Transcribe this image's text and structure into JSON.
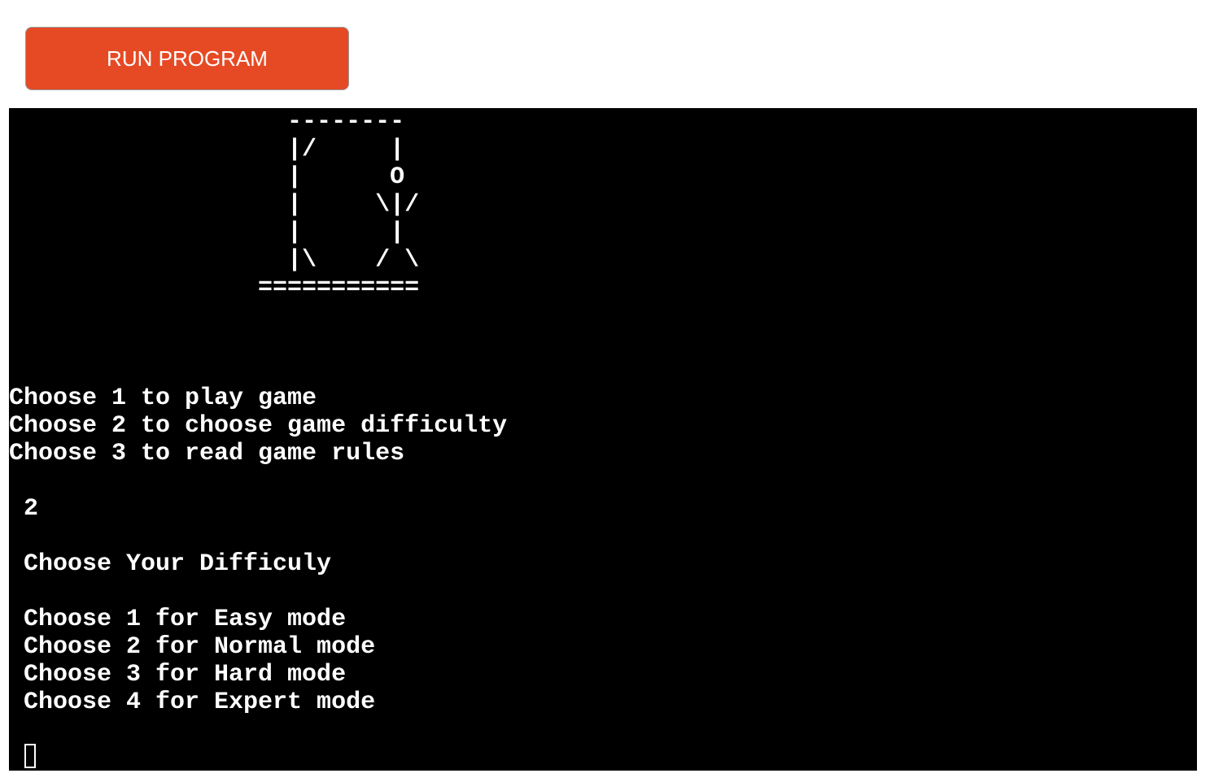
{
  "toolbar": {
    "run_label": "RUN PROGRAM",
    "accent_color": "#e64a25"
  },
  "terminal": {
    "background": "#000000",
    "foreground": "#ffffff",
    "gallows": [
      "                   --------",
      "                   |/     |",
      "                   |      O",
      "                   |     \\|/",
      "                   |      |",
      "                   |\\    / \\",
      "                 ==========="
    ],
    "lines": [
      "Choose 1 to play game",
      "Choose 2 to choose game difficulty",
      "Choose 3 to read game rules",
      "",
      " 2",
      "",
      " Choose Your Difficuly",
      "",
      " Choose 1 for Easy mode",
      " Choose 2 for Normal mode",
      " Choose 3 for Hard mode",
      " Choose 4 for Expert mode"
    ]
  }
}
